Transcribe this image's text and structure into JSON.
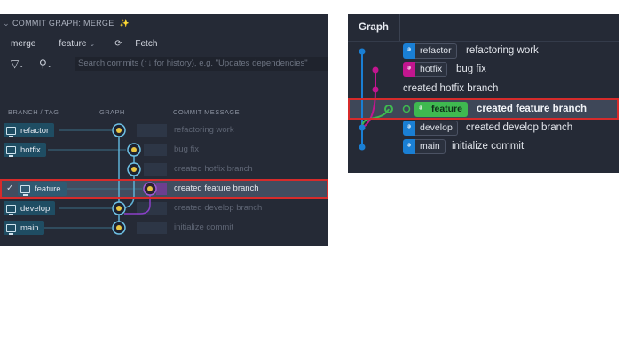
{
  "left_panel": {
    "title": "COMMIT GRAPH: MERGE",
    "toolbar": {
      "repo": "merge",
      "branch": "feature",
      "fetch": "Fetch"
    },
    "search_placeholder": "Search commits (↑↓ for history), e.g. \"Updates dependencies\"",
    "columns": {
      "branch_tag": "BRANCH / TAG",
      "graph": "GRAPH",
      "commit_message": "COMMIT MESSAGE"
    },
    "rows": [
      {
        "branch": "refactor",
        "message": "refactoring work"
      },
      {
        "branch": "hotfix",
        "message": "bug fix"
      },
      {
        "branch": "",
        "message": "created hotfix branch"
      },
      {
        "branch": "feature",
        "message": "created feature branch",
        "selected": true
      },
      {
        "branch": "develop",
        "message": "created develop branch"
      },
      {
        "branch": "main",
        "message": "initialize commit"
      }
    ]
  },
  "right_panel": {
    "header": "Graph",
    "rows": [
      {
        "branch": "refactor",
        "message": "refactoring work",
        "color": "#1a7fd4"
      },
      {
        "branch": "hotfix",
        "message": "bug fix",
        "color": "#c2168f"
      },
      {
        "branch": "",
        "message": "created hotfix branch",
        "color": "#c2168f"
      },
      {
        "branch": "feature",
        "message": "created feature branch",
        "color": "#3fb950",
        "selected": true
      },
      {
        "branch": "develop",
        "message": "created develop branch",
        "color": "#1a7fd4"
      },
      {
        "branch": "main",
        "message": "initialize commit",
        "color": "#1a7fd4"
      }
    ]
  },
  "colors": {
    "panel_bg": "#252a36",
    "selection_outline": "#d62b2b",
    "blue": "#1a7fd4",
    "magenta": "#c2168f",
    "green": "#3fb950",
    "purple": "#8b3fc9"
  }
}
